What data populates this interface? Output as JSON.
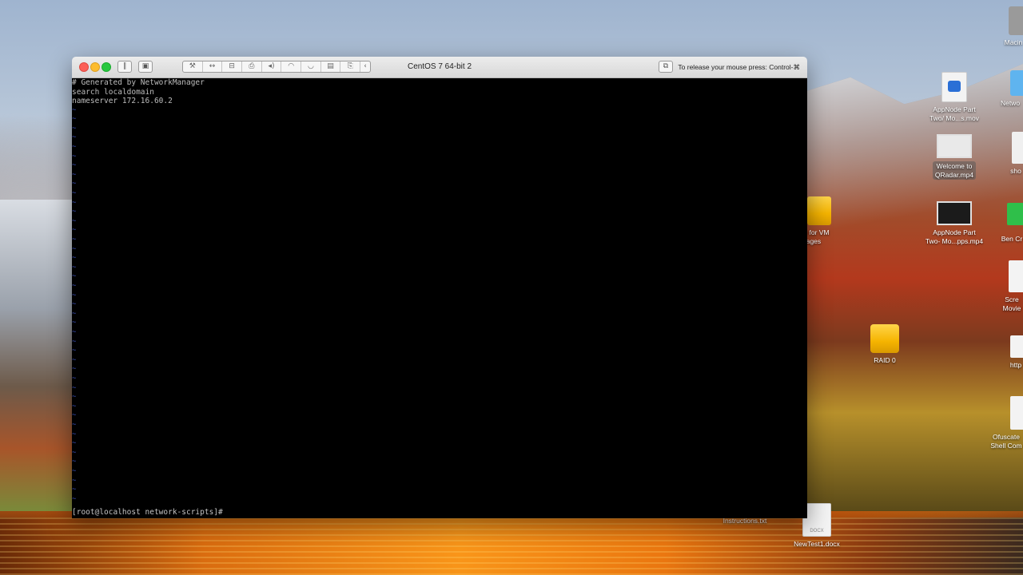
{
  "vm_window": {
    "title": "CentOS 7 64-bit 2",
    "release_hint": "To release your mouse press: Control-⌘",
    "toolbar": {
      "pause_icon": "pause-icon",
      "snapshot_icon": "snapshot-icon",
      "settings_icon": "wrench-icon",
      "network_icon": "arrows-icon",
      "disk_icon": "disk-icon",
      "printer_icon": "printer-icon",
      "sound_icon": "speaker-icon",
      "camera_icon": "camera-icon",
      "usb_icon": "usb-icon",
      "shared_icon": "shared-folder-icon",
      "collapse_icon": "chevron-left-icon"
    }
  },
  "terminal": {
    "lines": [
      "# Generated by NetworkManager",
      "search localdomain",
      "nameserver 172.16.60.2"
    ],
    "tilde": "~",
    "prompt": "[root@localhost network-scripts]#"
  },
  "desktop": {
    "icons": {
      "macintosh": "Macin",
      "appnode_movie_1": "AppNode Part\nTwo/ Mo...s.mov",
      "network": "Netwo",
      "welcome_qradar": "Welcome to\nQRadar.mp4",
      "sho": "sho",
      "vm_images": "D for VM\nnages",
      "appnode_movie_2": "AppNode Part\nTwo- Mo...pps.mp4",
      "ben": "Ben Cr",
      "screen_movie": "Scre\nMovie",
      "raid": "RAID 0",
      "https": "http",
      "ofuscate": "Ofuscate\nShell Com",
      "instructions": "Instructions.txt",
      "newtest": "NewTest1.docx",
      "docx_badge": "DOCX"
    }
  }
}
